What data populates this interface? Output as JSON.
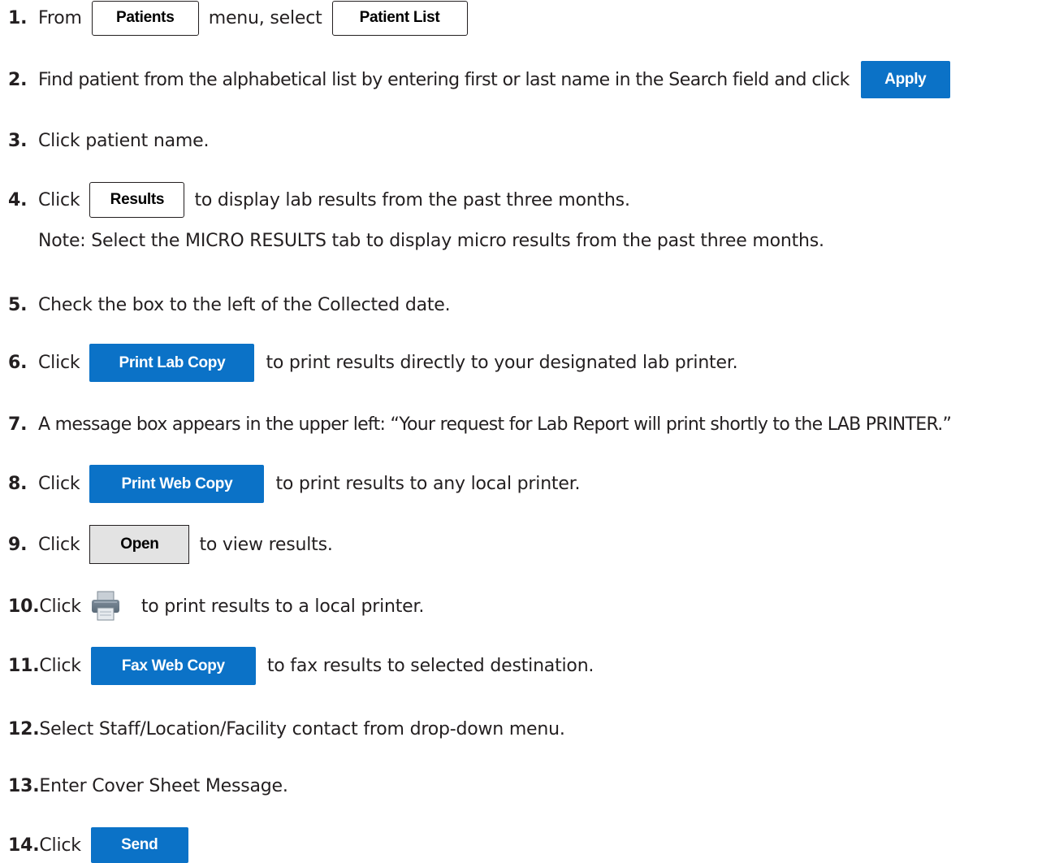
{
  "steps": [
    {
      "num": "1.",
      "a": "From",
      "btn1": "Patients",
      "b": "menu, select",
      "btn2": "Patient List"
    },
    {
      "num": "2.",
      "a": "Find patient from the alphabetical list by entering first or last name in the Search field and click",
      "btn": "Apply"
    },
    {
      "num": "3.",
      "a": "Click patient name."
    },
    {
      "num": "4.",
      "a": "Click",
      "btn": "Results",
      "b": "to display lab results from the past three months.",
      "note": "Note: Select the MICRO RESULTS tab to display micro results from the past three months."
    },
    {
      "num": "5.",
      "a": "Check the box to the left of the Collected date."
    },
    {
      "num": "6.",
      "a": "Click",
      "btn": "Print Lab Copy",
      "b": "to print results directly to your designated lab printer."
    },
    {
      "num": "7.",
      "a": "A message box appears in the upper left:  “Your request for Lab Report will print shortly to the LAB PRINTER.”"
    },
    {
      "num": "8.",
      "a": "Click",
      "btn": "Print Web Copy",
      "b": "to print results to any local printer."
    },
    {
      "num": "9.",
      "a": "Click",
      "btn": "Open",
      "b": "to view results."
    },
    {
      "num": "10.",
      "a": "Click",
      "icon": "printer-icon",
      "b": "to print results to a local printer."
    },
    {
      "num": "11.",
      "a": "Click",
      "btn": "Fax Web Copy",
      "b": "to fax results to selected destination."
    },
    {
      "num": "12.",
      "a": "Select Staff/Location/Facility contact from drop-down menu."
    },
    {
      "num": "13.",
      "a": "Enter Cover Sheet Message."
    },
    {
      "num": "14.",
      "a": "Click",
      "btn": "Send"
    }
  ],
  "colors": {
    "blue_button": "#0b72c7",
    "gray_button": "#e3e3e3",
    "text": "#231f20"
  }
}
